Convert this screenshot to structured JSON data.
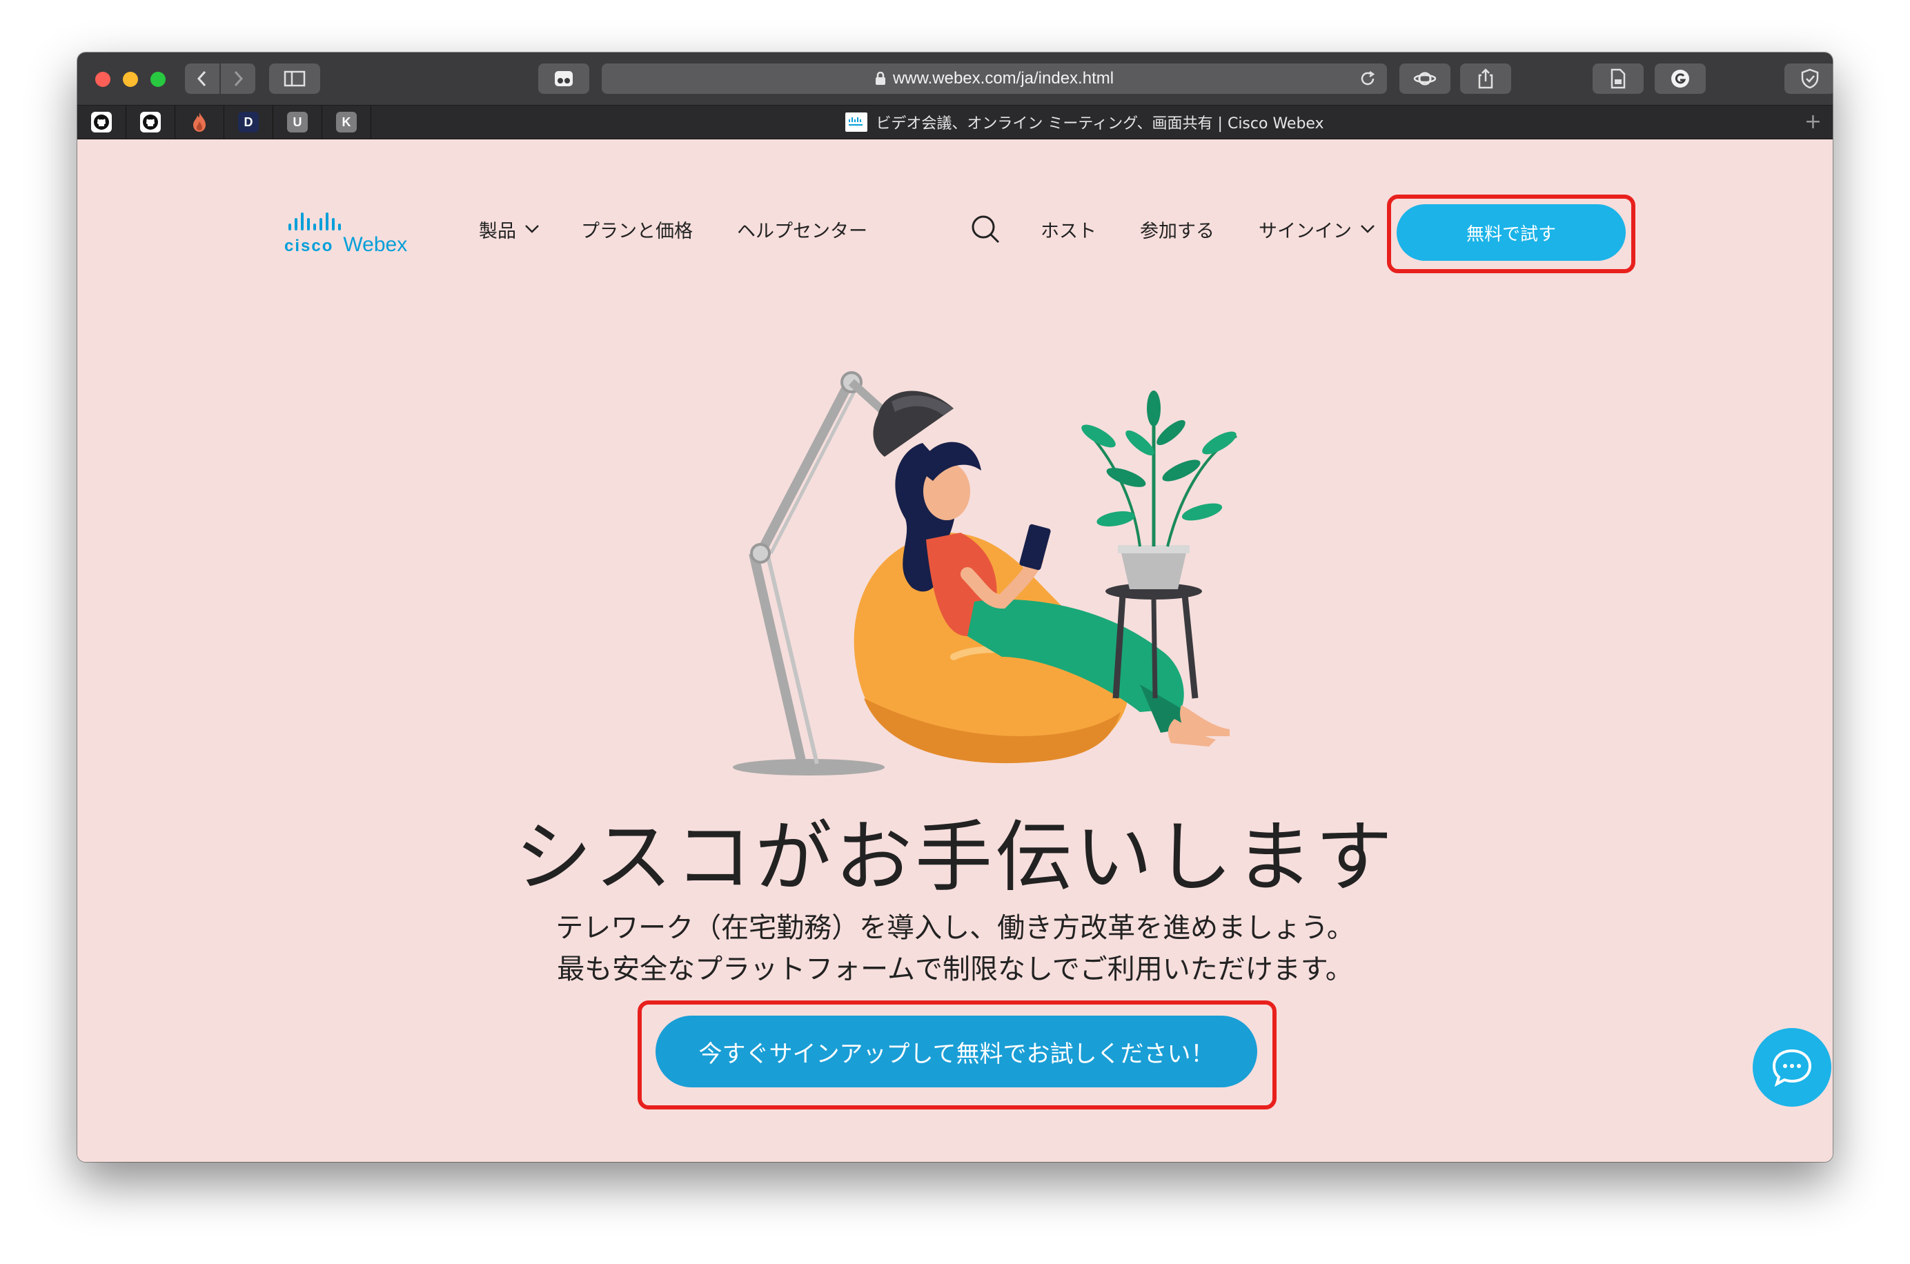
{
  "browser": {
    "url": "www.webex.com/ja/index.html",
    "tab_title": "ビデオ会議、オンライン ミーティング、画面共有 | Cisco Webex",
    "pinned_tabs": [
      "github-icon",
      "github-icon",
      "flame-icon",
      "d-app-icon",
      "u-app-icon",
      "k-app-icon"
    ],
    "pinned_labels": {
      "d": "D",
      "u": "U",
      "k": "K"
    },
    "new_tab_symbol": "+"
  },
  "nav": {
    "logo_cisco": "cisco",
    "logo_webex": "Webex",
    "products": "製品",
    "plans": "プランと価格",
    "help": "ヘルプセンター",
    "host": "ホスト",
    "join": "参加する",
    "signin": "サインイン",
    "try_free": "無料で試す"
  },
  "hero": {
    "headline": "シスコがお手伝いします",
    "line1": "テレワーク（在宅勤務）を導入し、働き方改革を進めましょう。",
    "line2": "最も安全なプラットフォームで制限なしでご利用いただけます。",
    "cta": "今すぐサインアップして無料でお試しください！"
  },
  "colors": {
    "page_bg": "#f6dedc",
    "brand_blue": "#049fd9",
    "cta_blue": "#1a9ed6",
    "highlight_red": "#e8201d"
  }
}
